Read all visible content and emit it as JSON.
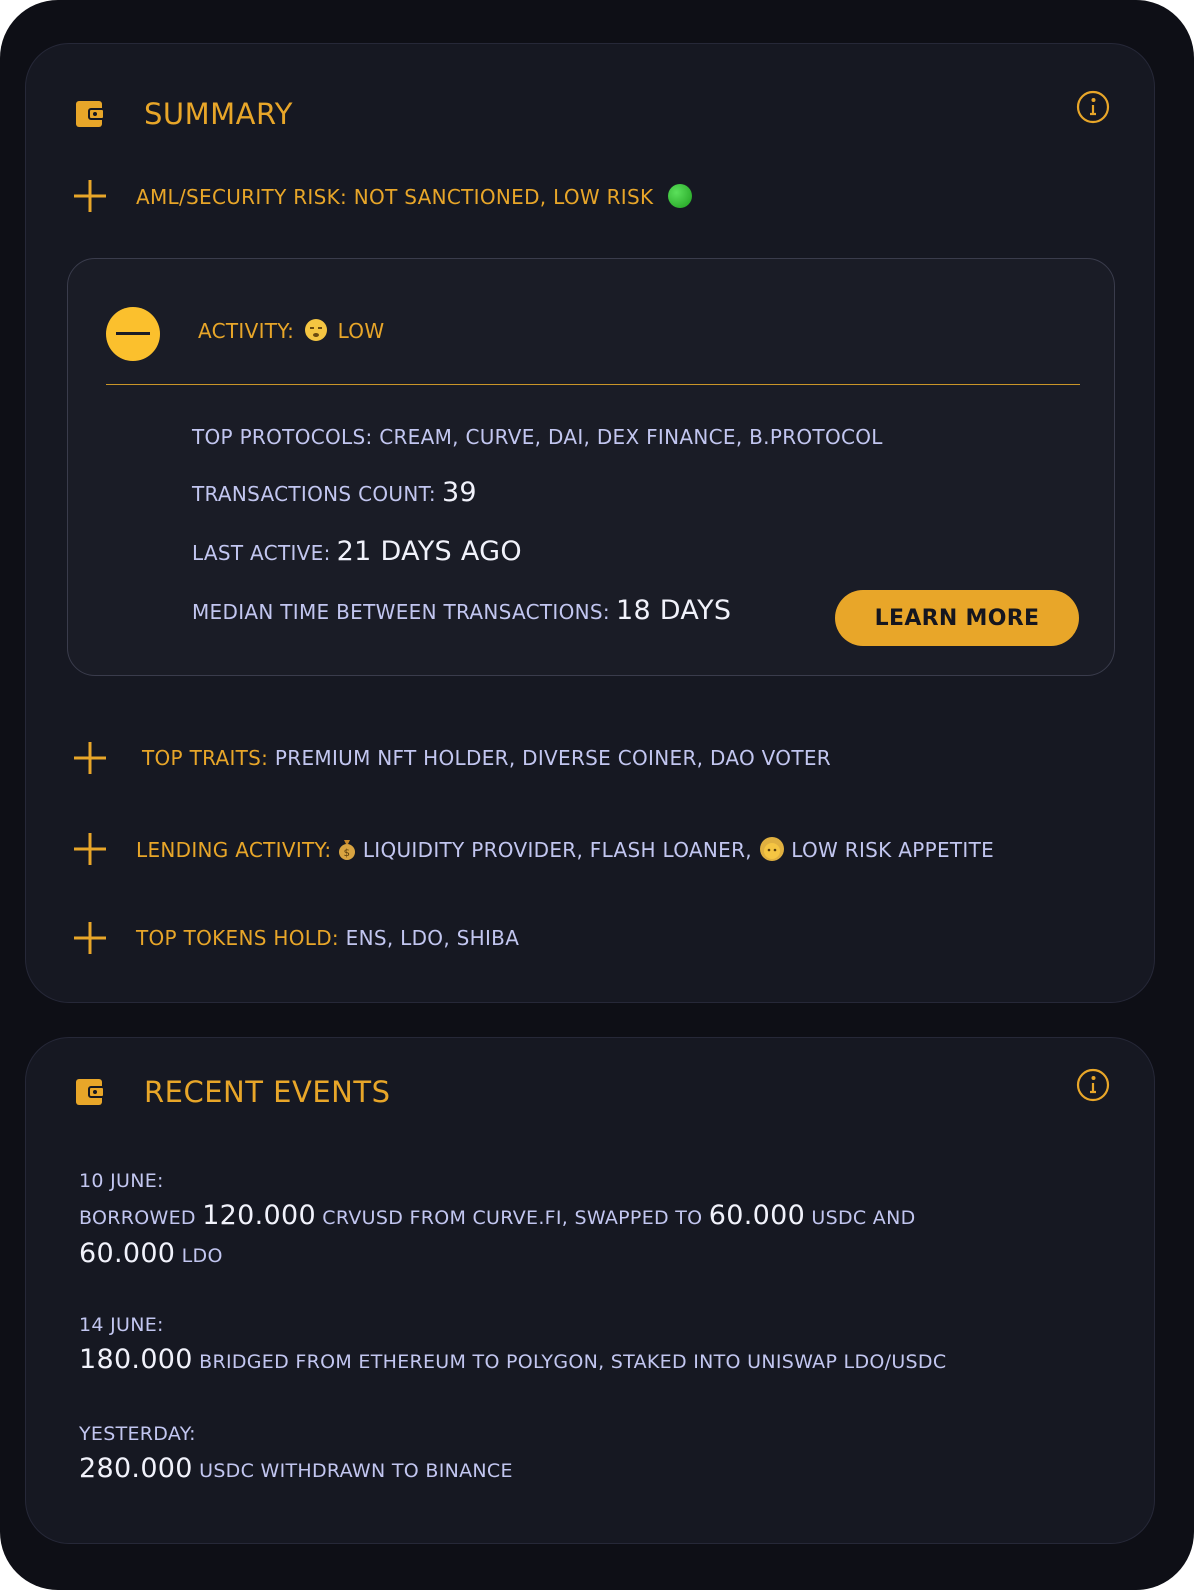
{
  "colors": {
    "accent": "#e8a629",
    "text_secondary": "#c2c6f0",
    "text_primary": "#f1f2fb",
    "background": "#0e0f16",
    "card": "#161822",
    "status_green": "#2fbf2f"
  },
  "summary": {
    "title": "SUMMARY",
    "icon": "wallet-icon",
    "info_icon": "info-icon",
    "aml": {
      "label": "AML/SECURITY RISK:",
      "value": "NOT SANCTIONED, LOW RISK",
      "status_icon": "green-circle-icon"
    },
    "activity": {
      "label": "ACTIVITY:",
      "level": "LOW",
      "level_icon": "sleepy-face-icon",
      "top_protocols_label": "TOP PROTOCOLS:",
      "top_protocols": "CREAM, CURVE, DAI, DEX FINANCE, B.PROTOCOL",
      "tx_count_label": "TRANSACTIONS COUNT:",
      "tx_count": "39",
      "last_active_label": "LAST ACTIVE:",
      "last_active": "21 DAYS AGO",
      "median_label": "MEDIAN TIME BETWEEN TRANSACTIONS:",
      "median": "18 DAYS",
      "learn_more": "LEARN MORE"
    },
    "traits": {
      "label": "TOP TRAITS:",
      "value": "PREMIUM NFT HOLDER, DIVERSE COINER, DAO VOTER"
    },
    "lending": {
      "label": "LENDING ACTIVITY:",
      "part1": "LIQUIDITY PROVIDER, FLASH LOANER,",
      "part2": "LOW RISK APPETITE",
      "icon1": "money-bag-icon",
      "icon2": "old-person-icon"
    },
    "tokens": {
      "label": "TOP TOKENS HOLD:",
      "value": "ENS, LDO, SHIBA"
    }
  },
  "events": {
    "title": "RECENT EVENTS",
    "icon": "wallet-icon",
    "info_icon": "info-icon",
    "items": [
      {
        "date": "10 JUNE:",
        "t1": "BORROWED",
        "n1": "120.000",
        "t2": "CRVUSD FROM CURVE.FI, SWAPPED TO",
        "n2": "60.000",
        "t3": "USDC AND",
        "n3": "60.000",
        "t4": "LDO"
      },
      {
        "date": "14 JUNE:",
        "n1": "180.000",
        "t1": "BRIDGED FROM ETHEREUM TO POLYGON, STAKED INTO UNISWAP LDO/USDC"
      },
      {
        "date": "YESTERDAY:",
        "n1": "280.000",
        "t1": "USDC WITHDRAWN TO BINANCE"
      }
    ]
  }
}
